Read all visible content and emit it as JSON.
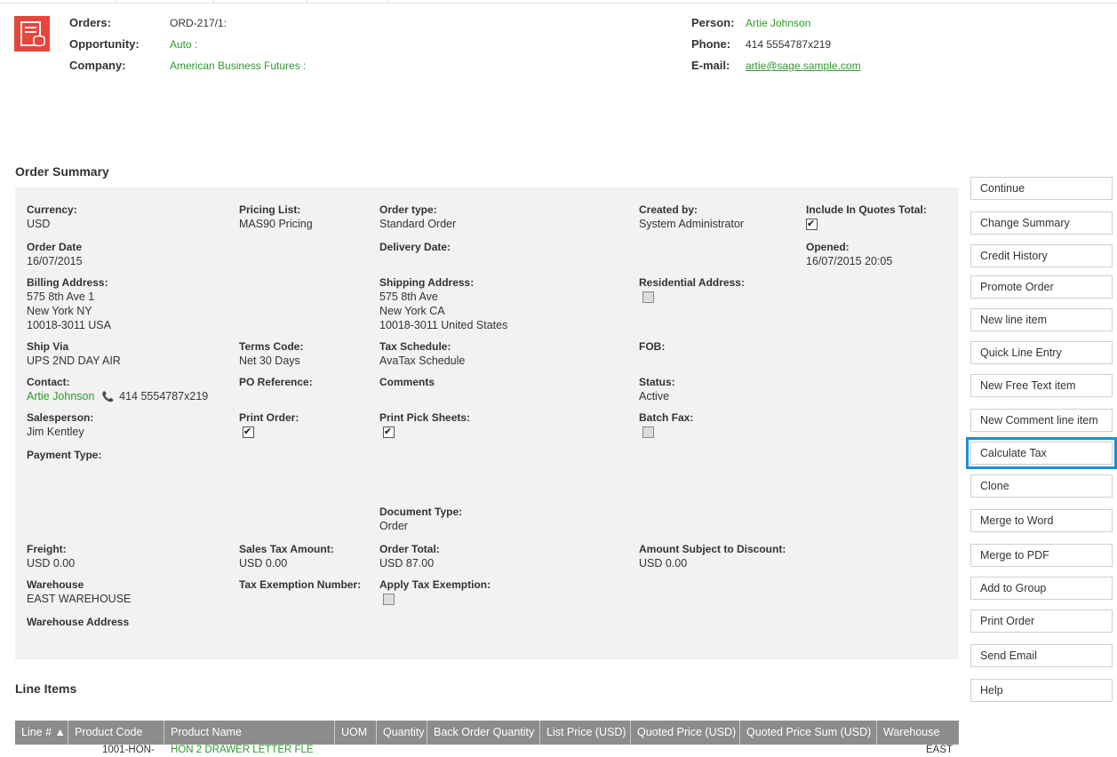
{
  "header": {
    "orders_label": "Orders:",
    "orders_value": "ORD-217/1:",
    "opportunity_label": "Opportunity:",
    "opportunity_value": "Auto :",
    "company_label": "Company:",
    "company_value": "American Business Futures :",
    "person_label": "Person:",
    "person_value": "Artie Johnson",
    "phone_label": "Phone:",
    "phone_value": "414 5554787x219",
    "email_label": "E-mail:",
    "email_value": "artie@sage.sample.com"
  },
  "order_summary": {
    "title": "Order Summary",
    "currency_label": "Currency:",
    "currency_value": "USD",
    "pricing_list_label": "Pricing List:",
    "pricing_list_value": "MAS90 Pricing",
    "order_type_label": "Order type:",
    "order_type_value": "Standard Order",
    "created_by_label": "Created by:",
    "created_by_value": "System Administrator",
    "include_quotes_label": "Include In Quotes Total:",
    "include_quotes_checked": true,
    "order_date_label": "Order Date",
    "order_date_value": "16/07/2015",
    "delivery_date_label": "Delivery Date:",
    "opened_label": "Opened:",
    "opened_value": "16/07/2015 20:05",
    "billing_label": "Billing Address:",
    "billing_line1": "575 8th Ave 1",
    "billing_line2": "New York NY",
    "billing_line3": "10018-3011 USA",
    "shipping_label": "Shipping Address:",
    "shipping_line1": "575 8th Ave",
    "shipping_line2": "New York CA",
    "shipping_line3": "10018-3011 United States",
    "residential_label": "Residential Address:",
    "residential_checked": false,
    "ship_via_label": "Ship Via",
    "ship_via_value": "UPS 2ND DAY AIR",
    "terms_label": "Terms Code:",
    "terms_value": "Net 30 Days",
    "tax_schedule_label": "Tax Schedule:",
    "tax_schedule_value": "AvaTax Schedule",
    "fob_label": "FOB:",
    "contact_label": "Contact:",
    "contact_name": "Artie Johnson",
    "contact_phone": "414 5554787x219",
    "po_label": "PO Reference:",
    "comments_label": "Comments",
    "status_label": "Status:",
    "status_value": "Active",
    "salesperson_label": "Salesperson:",
    "salesperson_value": "Jim Kentley",
    "print_order_label": "Print Order:",
    "print_order_checked": true,
    "print_pick_label": "Print Pick Sheets:",
    "print_pick_checked": true,
    "batch_fax_label": "Batch Fax:",
    "batch_fax_checked": false,
    "payment_type_label": "Payment Type:",
    "document_type_label": "Document Type:",
    "document_type_value": "Order",
    "freight_label": "Freight:",
    "freight_value": "USD 0.00",
    "sales_tax_label": "Sales Tax Amount:",
    "sales_tax_value": "USD 0.00",
    "order_total_label": "Order Total:",
    "order_total_value": "USD 87.00",
    "amount_discount_label": "Amount Subject to Discount:",
    "amount_discount_value": "USD 0.00",
    "warehouse_label": "Warehouse",
    "warehouse_value": "EAST WAREHOUSE",
    "tax_exemption_label": "Tax Exemption Number:",
    "apply_tax_label": "Apply Tax Exemption:",
    "apply_tax_checked": false,
    "warehouse_address_label": "Warehouse Address"
  },
  "actions": [
    "Continue",
    "Change Summary",
    "Credit History",
    "Promote Order",
    "New line item",
    "Quick Line Entry",
    "New Free Text item",
    "New Comment line item",
    "Calculate Tax",
    "Clone",
    "Merge to Word",
    "Merge to PDF",
    "Add to Group",
    "Print Order",
    "Send Email",
    "Help"
  ],
  "line_items": {
    "title": "Line Items",
    "columns": [
      "Line #",
      "Product Code",
      "Product Name",
      "UOM",
      "Quantity",
      "Back Order Quantity",
      "List Price (USD)",
      "Quoted Price (USD)",
      "Quoted Price Sum (USD)",
      "Warehouse"
    ],
    "rows": [
      {
        "product_code": "1001-HON-",
        "product_name": "HON 2 DRAWER LETTER FLE",
        "warehouse": "EAST"
      }
    ]
  },
  "colors": {
    "accent": "#1a8fd6",
    "link": "#2c9a2c",
    "header_grid": "#8c8c8c",
    "logo": "#e8453c"
  }
}
